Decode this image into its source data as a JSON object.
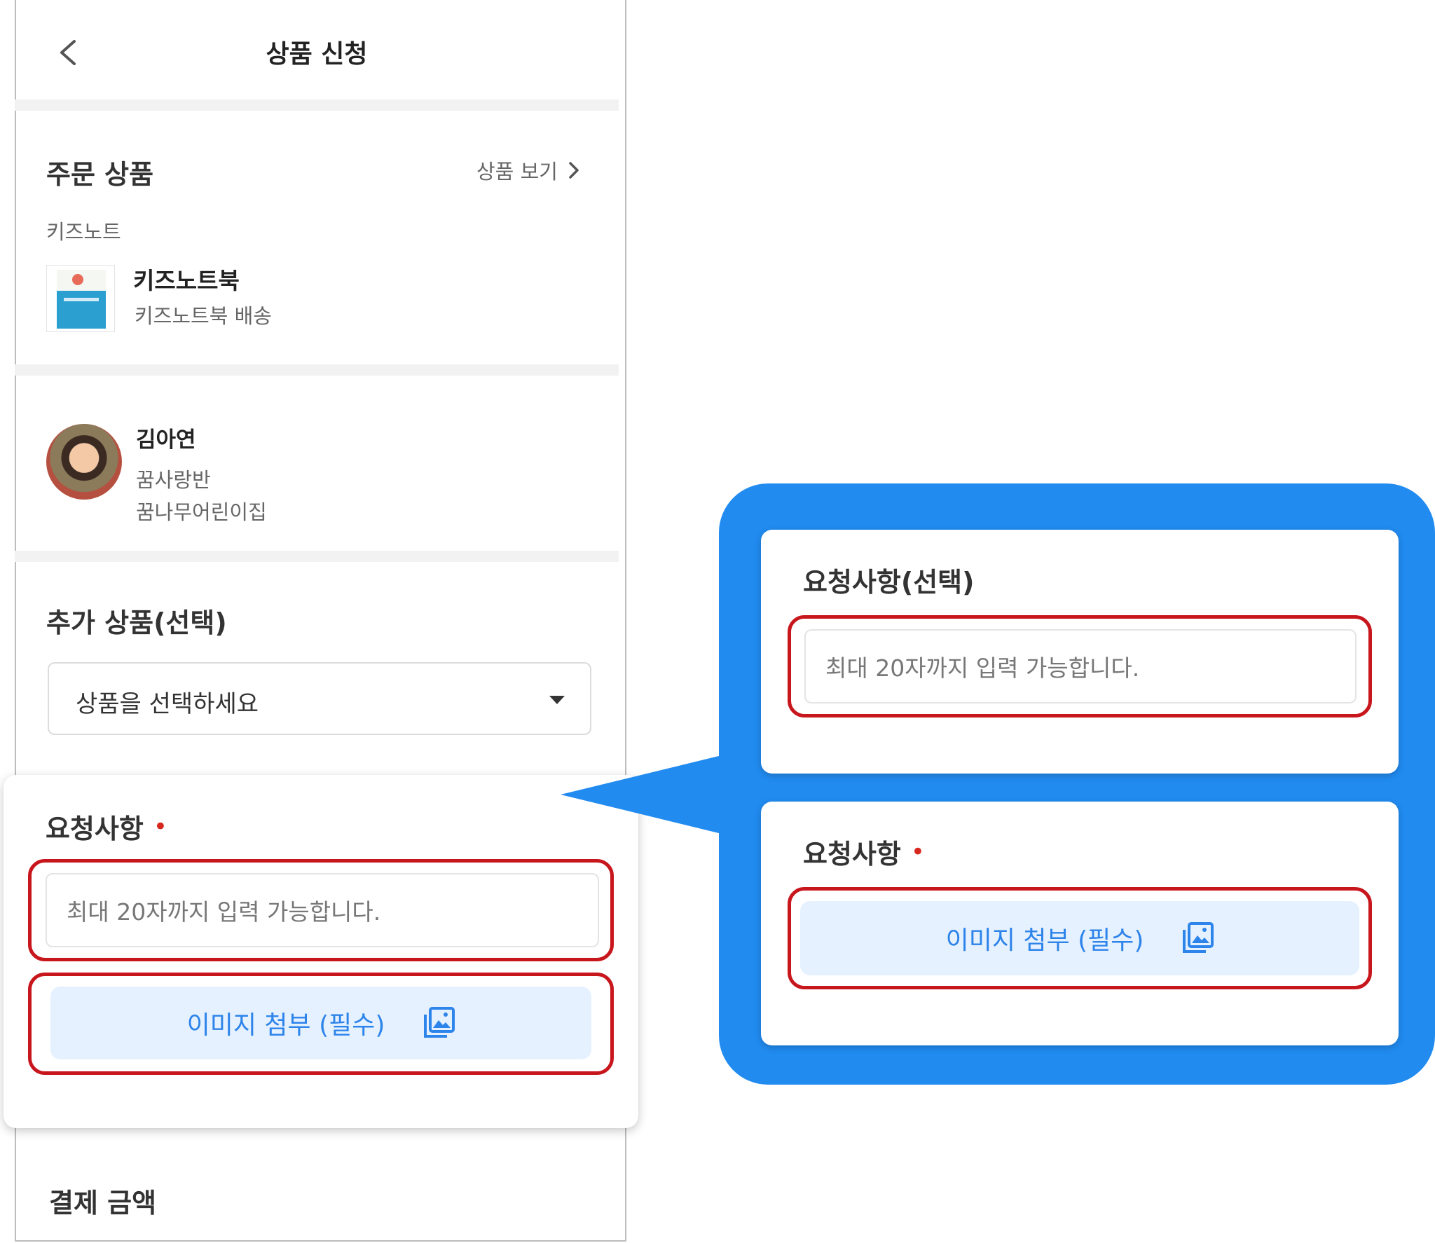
{
  "header": {
    "title": "상품 신청"
  },
  "order": {
    "section_title": "주문 상품",
    "view_link": "상품 보기",
    "brand": "키즈노트",
    "product_name": "키즈노트북",
    "product_desc": "키즈노트북 배송"
  },
  "child": {
    "name": "김아연",
    "class": "꿈사랑반",
    "school": "꿈나무어린이집"
  },
  "extra": {
    "section_title": "추가 상품(선택)",
    "select_placeholder": "상품을 선택하세요"
  },
  "request": {
    "section_title": "요청사항",
    "required_mark": "•",
    "input_placeholder": "최대 20자까지 입력 가능합니다.",
    "attach_label": "이미지 첨부 (필수)"
  },
  "payment": {
    "section_title": "결제 금액"
  },
  "callout": {
    "optional_title": "요청사항(선택)",
    "optional_placeholder": "최대 20자까지 입력 가능합니다.",
    "required_title": "요청사항",
    "required_mark": "•",
    "attach_label": "이미지 첨부 (필수)"
  },
  "colors": {
    "accent_blue": "#2d84ea",
    "callout_blue": "#218bf0",
    "highlight_red": "#c8161d",
    "attach_bg": "#e6f1ff"
  }
}
